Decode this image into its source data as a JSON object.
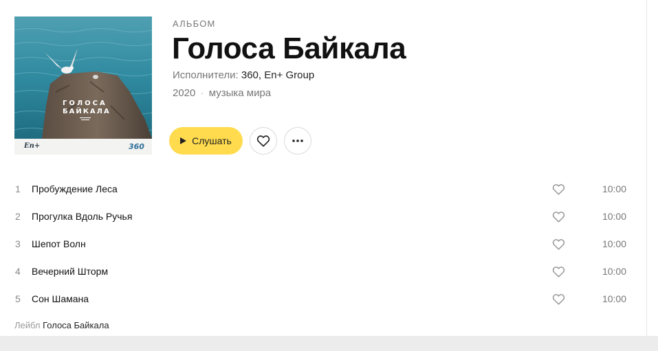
{
  "album": {
    "type": "АЛЬБОМ",
    "title": "Голоса Байкала",
    "artists_label": "Исполнители:",
    "artists": "360, En+ Group",
    "year": "2020",
    "separator": "·",
    "genre": "музыка мира",
    "cover": {
      "title_line1": "ГОЛОСА",
      "title_line2": "БАЙКАЛА",
      "logo_left": "En+",
      "logo_right": "360"
    }
  },
  "actions": {
    "play_label": "Слушать",
    "play_icon": "play-icon",
    "like_icon": "heart-icon",
    "more_icon": "more-icon"
  },
  "tracks": [
    {
      "number": "1",
      "title": "Пробуждение Леса",
      "duration": "10:00"
    },
    {
      "number": "2",
      "title": "Прогулка Вдоль Ручья",
      "duration": "10:00"
    },
    {
      "number": "3",
      "title": "Шепот Волн",
      "duration": "10:00"
    },
    {
      "number": "4",
      "title": "Вечерний Шторм",
      "duration": "10:00"
    },
    {
      "number": "5",
      "title": "Сон Шамана",
      "duration": "10:00"
    }
  ],
  "footer": {
    "label_key": "Лейбл",
    "label_value": "Голоса Байкала"
  },
  "colors": {
    "accent": "#ffdb4d",
    "sea": "#2a7f95"
  }
}
